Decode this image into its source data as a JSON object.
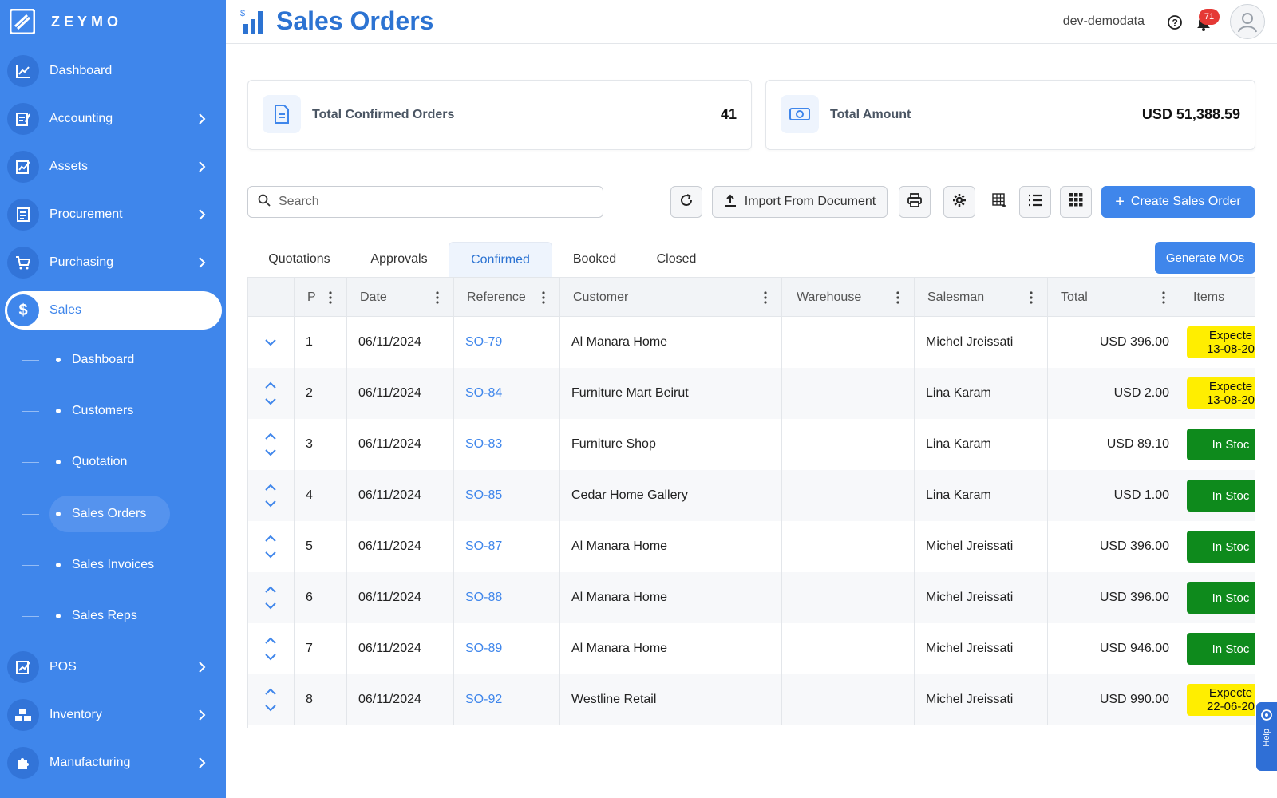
{
  "brand": {
    "name": "ZEYMO"
  },
  "sidebar": {
    "items": [
      {
        "label": "Dashboard",
        "icon": "chart-icon",
        "has_chevron": false
      },
      {
        "label": "Accounting",
        "icon": "ledger-icon",
        "has_chevron": true
      },
      {
        "label": "Assets",
        "icon": "asset-chart-icon",
        "has_chevron": true
      },
      {
        "label": "Procurement",
        "icon": "document-icon",
        "has_chevron": true
      },
      {
        "label": "Purchasing",
        "icon": "cart-icon",
        "has_chevron": true
      },
      {
        "label": "Sales",
        "icon": "dollar-icon",
        "has_chevron": false,
        "active": true
      },
      {
        "label": "POS",
        "icon": "pos-icon",
        "has_chevron": true
      },
      {
        "label": "Inventory",
        "icon": "boxes-icon",
        "has_chevron": true
      },
      {
        "label": "Manufacturing",
        "icon": "puzzle-icon",
        "has_chevron": true
      }
    ],
    "sales_submenu": [
      {
        "label": "Dashboard"
      },
      {
        "label": "Customers"
      },
      {
        "label": "Quotation"
      },
      {
        "label": "Sales Orders",
        "active": true
      },
      {
        "label": "Sales Invoices"
      },
      {
        "label": "Sales Reps"
      }
    ]
  },
  "header": {
    "title": "Sales Orders",
    "tenant": "dev-demodata",
    "notification_count": "71"
  },
  "summary": {
    "confirmed_label": "Total Confirmed Orders",
    "confirmed_value": "41",
    "amount_label": "Total Amount",
    "amount_value": "USD 51,388.59"
  },
  "toolbar": {
    "search_placeholder": "Search",
    "import_label": "Import From Document",
    "create_label": "Create Sales Order"
  },
  "tabs": [
    {
      "label": "Quotations"
    },
    {
      "label": "Approvals"
    },
    {
      "label": "Confirmed",
      "active": true
    },
    {
      "label": "Booked"
    },
    {
      "label": "Closed"
    }
  ],
  "generate_label": "Generate MOs",
  "table": {
    "columns": [
      "P",
      "Date",
      "Reference",
      "Customer",
      "Warehouse",
      "Salesman",
      "Total",
      "Items"
    ],
    "rows": [
      {
        "p": "1",
        "date": "06/11/2024",
        "ref": "SO-79",
        "customer": "Al Manara Home",
        "warehouse": "",
        "salesman": "Michel Jreissati",
        "total": "USD 396.00",
        "status": "Expecte",
        "status_date": "13-08-20",
        "type": "expected",
        "first": true
      },
      {
        "p": "2",
        "date": "06/11/2024",
        "ref": "SO-84",
        "customer": "Furniture Mart Beirut",
        "warehouse": "",
        "salesman": "Lina Karam",
        "total": "USD 2.00",
        "status": "Expecte",
        "status_date": "13-08-20",
        "type": "expected"
      },
      {
        "p": "3",
        "date": "06/11/2024",
        "ref": "SO-83",
        "customer": "Furniture Shop",
        "warehouse": "",
        "salesman": "Lina Karam",
        "total": "USD 89.10",
        "status": "In Stoc",
        "status_date": "",
        "type": "instock"
      },
      {
        "p": "4",
        "date": "06/11/2024",
        "ref": "SO-85",
        "customer": "Cedar Home Gallery",
        "warehouse": "",
        "salesman": "Lina Karam",
        "total": "USD 1.00",
        "status": "In Stoc",
        "status_date": "",
        "type": "instock"
      },
      {
        "p": "5",
        "date": "06/11/2024",
        "ref": "SO-87",
        "customer": "Al Manara Home",
        "warehouse": "",
        "salesman": "Michel Jreissati",
        "total": "USD 396.00",
        "status": "In Stoc",
        "status_date": "",
        "type": "instock"
      },
      {
        "p": "6",
        "date": "06/11/2024",
        "ref": "SO-88",
        "customer": "Al Manara Home",
        "warehouse": "",
        "salesman": "Michel Jreissati",
        "total": "USD 396.00",
        "status": "In Stoc",
        "status_date": "",
        "type": "instock"
      },
      {
        "p": "7",
        "date": "06/11/2024",
        "ref": "SO-89",
        "customer": "Al Manara Home",
        "warehouse": "",
        "salesman": "Michel Jreissati",
        "total": "USD 946.00",
        "status": "In Stoc",
        "status_date": "",
        "type": "instock"
      },
      {
        "p": "8",
        "date": "06/11/2024",
        "ref": "SO-92",
        "customer": "Westline Retail",
        "warehouse": "",
        "salesman": "Michel Jreissati",
        "total": "USD 990.00",
        "status": "Expecte",
        "status_date": "22-06-20",
        "type": "expected"
      }
    ]
  },
  "help_tab_label": "Help",
  "colors": {
    "accent": "#3f86eb",
    "expected": "#ffee00",
    "in_stock": "#0e8a1c",
    "badge": "#e53935"
  }
}
